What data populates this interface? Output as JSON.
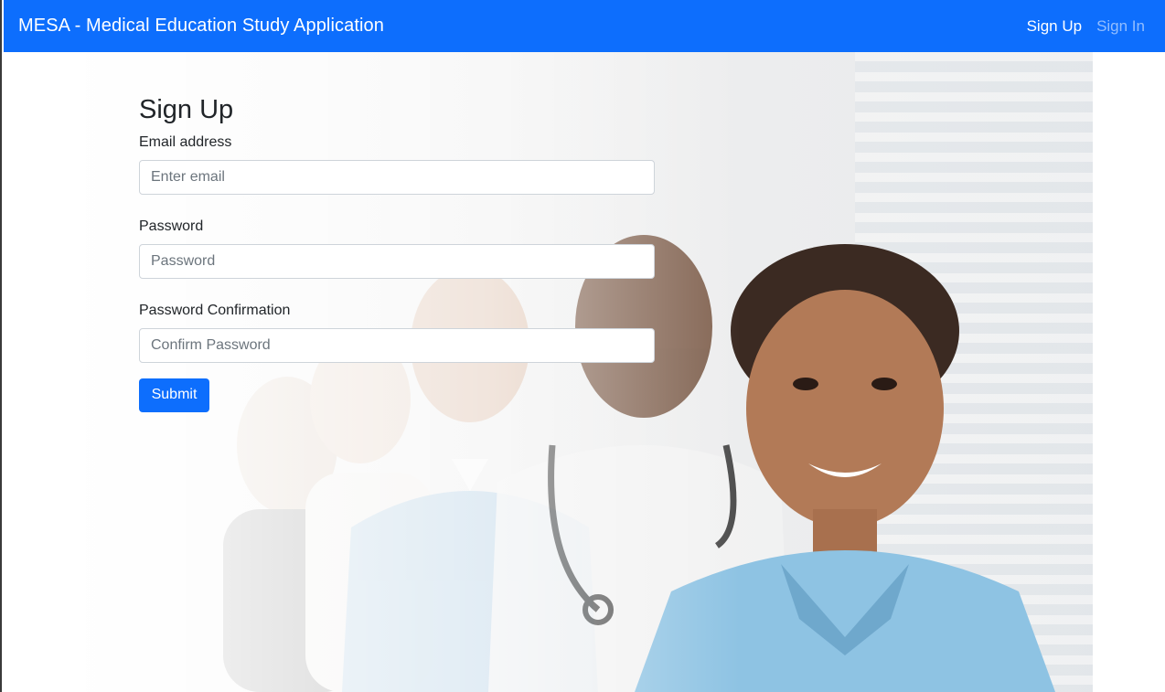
{
  "navbar": {
    "brand": "MESA - Medical Education Study Application",
    "links": [
      {
        "label": "Sign Up",
        "active": true
      },
      {
        "label": "Sign In",
        "active": false
      }
    ]
  },
  "form": {
    "title": "Sign Up",
    "email_label": "Email address",
    "email_placeholder": "Enter email",
    "password_label": "Password",
    "password_placeholder": "Password",
    "confirm_label": "Password Confirmation",
    "confirm_placeholder": "Confirm Password",
    "submit_label": "Submit"
  },
  "colors": {
    "primary": "#0d6efd",
    "scrub_blue": "#8ec3e3"
  }
}
